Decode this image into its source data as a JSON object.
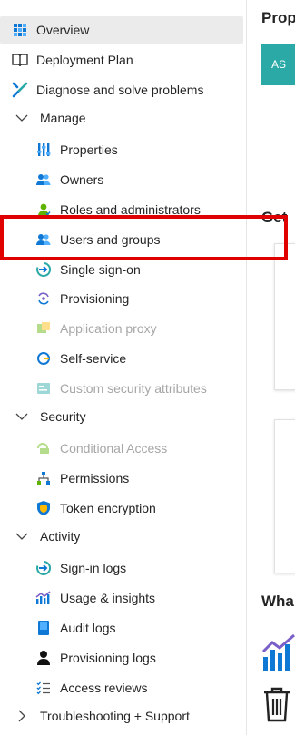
{
  "sidebar": {
    "items": [
      {
        "label": "Overview",
        "icon": "overview-grid-icon"
      },
      {
        "label": "Deployment Plan",
        "icon": "book-icon"
      },
      {
        "label": "Diagnose and solve problems",
        "icon": "wrench-icon"
      },
      {
        "label": "Manage",
        "icon": "chevron-down-icon"
      },
      {
        "label": "Properties",
        "icon": "properties-icon"
      },
      {
        "label": "Owners",
        "icon": "owners-icon"
      },
      {
        "label": "Roles and administrators",
        "icon": "roles-icon"
      },
      {
        "label": "Users and groups",
        "icon": "users-groups-icon"
      },
      {
        "label": "Single sign-on",
        "icon": "sso-icon"
      },
      {
        "label": "Provisioning",
        "icon": "provisioning-icon"
      },
      {
        "label": "Application proxy",
        "icon": "app-proxy-icon"
      },
      {
        "label": "Self-service",
        "icon": "self-service-icon"
      },
      {
        "label": "Custom security attributes",
        "icon": "custom-attributes-icon"
      },
      {
        "label": "Security",
        "icon": "chevron-down-icon"
      },
      {
        "label": "Conditional Access",
        "icon": "conditional-access-icon"
      },
      {
        "label": "Permissions",
        "icon": "permissions-icon"
      },
      {
        "label": "Token encryption",
        "icon": "shield-icon"
      },
      {
        "label": "Activity",
        "icon": "chevron-down-icon"
      },
      {
        "label": "Sign-in logs",
        "icon": "sign-in-icon"
      },
      {
        "label": "Usage & insights",
        "icon": "insights-icon"
      },
      {
        "label": "Audit logs",
        "icon": "audit-icon"
      },
      {
        "label": "Provisioning logs",
        "icon": "person-icon"
      },
      {
        "label": "Access reviews",
        "icon": "access-reviews-icon"
      },
      {
        "label": "Troubleshooting + Support",
        "icon": "chevron-right-icon"
      }
    ]
  },
  "main": {
    "properties_heading": "Prop",
    "avatar_initials": "AS",
    "getting_started_heading": "Get",
    "whats_new_heading": "Wha"
  },
  "colors": {
    "highlight": "#e00000",
    "selected_bg": "#ebebeb",
    "avatar_bg": "#2aa9a6",
    "azure_blue": "#0f78d4"
  }
}
